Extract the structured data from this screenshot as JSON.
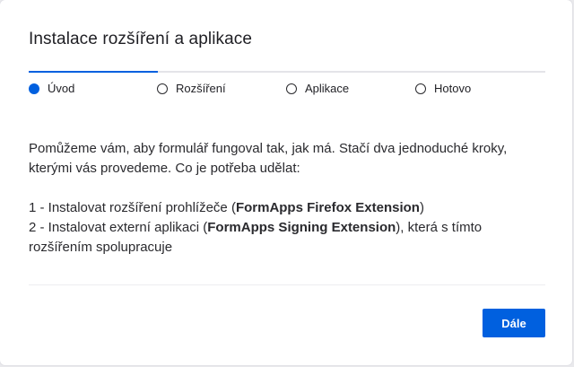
{
  "dialog": {
    "title": "Instalace rozšíření a aplikace",
    "progress": {
      "current_step": 1,
      "total_steps": 4
    },
    "steps": [
      {
        "label": "Úvod",
        "active": true
      },
      {
        "label": "Rozšíření",
        "active": false
      },
      {
        "label": "Aplikace",
        "active": false
      },
      {
        "label": "Hotovo",
        "active": false
      }
    ],
    "content": {
      "intro": "Pomůžeme vám, aby formulář fungoval tak, jak má. Stačí dva jednoduché kroky, kterými vás provedeme. Co je potřeba udělat:",
      "step1_prefix": "1 - Instalovat rozšíření prohlížeče (",
      "step1_bold": "FormApps Firefox Extension",
      "step1_suffix": ")",
      "step2_prefix": "2 - Instalovat externí aplikaci (",
      "step2_bold": "FormApps Signing Extension",
      "step2_suffix": "), která s tímto rozšířením spolupracuje"
    },
    "next_button_label": "Dále",
    "accent_color": "#0060df"
  }
}
